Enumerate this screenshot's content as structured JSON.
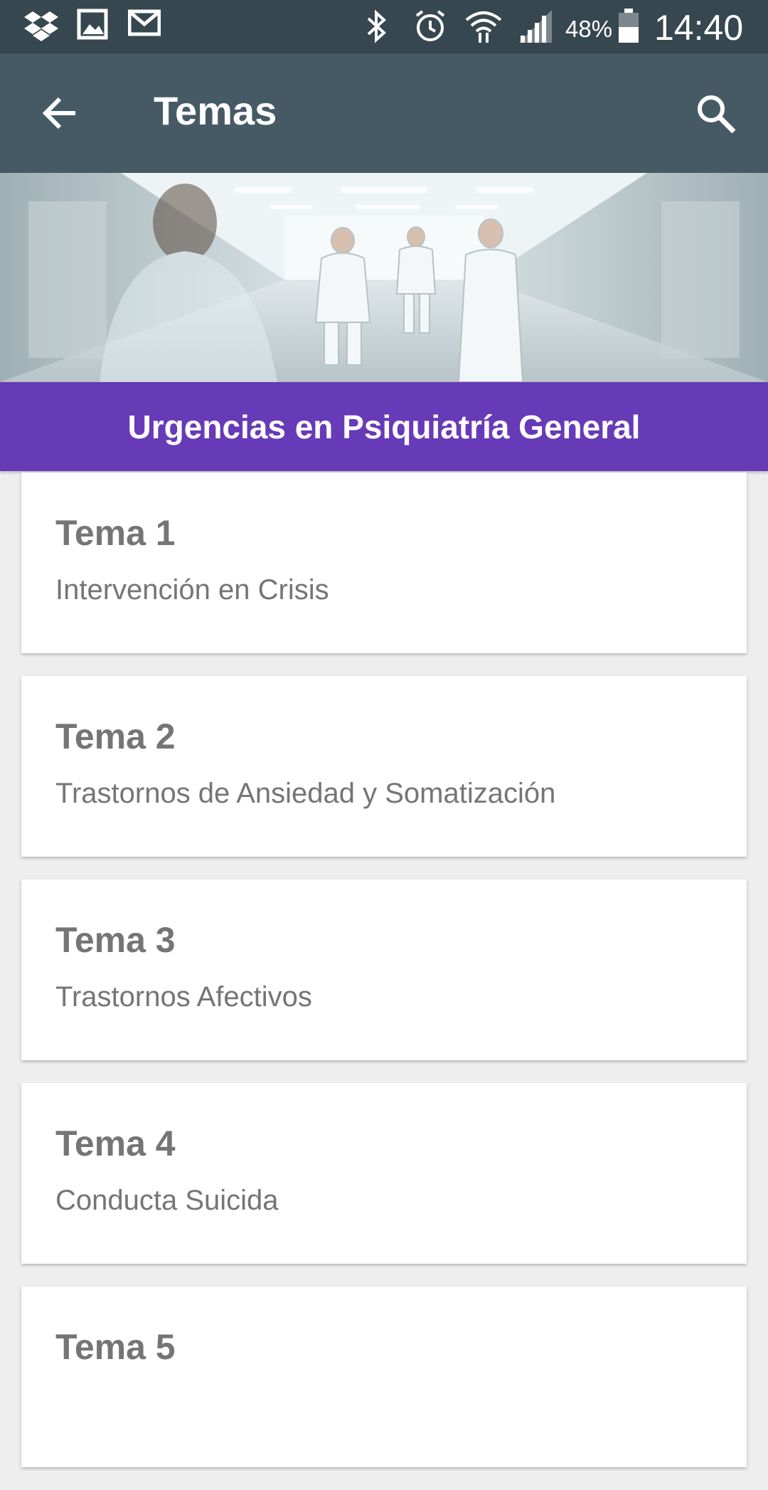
{
  "status_bar": {
    "battery": "48%",
    "time": "14:40",
    "icons": [
      "dropbox-icon",
      "gallery-icon",
      "gmail-icon",
      "bluetooth-icon",
      "alarm-icon",
      "wifi-icon",
      "signal-icon",
      "battery-icon"
    ]
  },
  "app_bar": {
    "title": "Temas",
    "back_icon": "arrow-back-icon",
    "search_icon": "search-icon"
  },
  "banner": {
    "title": "Urgencias en Psiquiatría General",
    "color": "#673ab7"
  },
  "topics": [
    {
      "title": "Tema 1",
      "subtitle": "Intervención en Crisis"
    },
    {
      "title": "Tema 2",
      "subtitle": "Trastornos de Ansiedad y Somatización"
    },
    {
      "title": "Tema 3",
      "subtitle": "Trastornos Afectivos"
    },
    {
      "title": "Tema 4",
      "subtitle": "Conducta Suicida"
    },
    {
      "title": "Tema 5",
      "subtitle": ""
    }
  ],
  "colors": {
    "status_bar": "#37474f",
    "app_bar": "#455a64",
    "background": "#eeeeee",
    "card_text": "#757575"
  }
}
